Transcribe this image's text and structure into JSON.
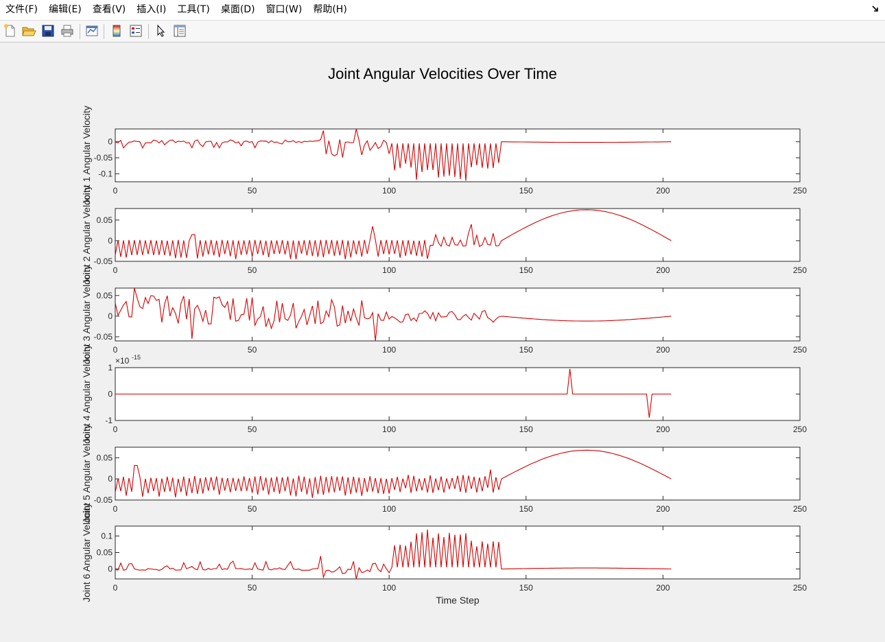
{
  "menubar": {
    "items": [
      {
        "label": "文件(F)",
        "name": "menu-file"
      },
      {
        "label": "编辑(E)",
        "name": "menu-edit"
      },
      {
        "label": "查看(V)",
        "name": "menu-view"
      },
      {
        "label": "插入(I)",
        "name": "menu-insert"
      },
      {
        "label": "工具(T)",
        "name": "menu-tools"
      },
      {
        "label": "桌面(D)",
        "name": "menu-desktop"
      },
      {
        "label": "窗口(W)",
        "name": "menu-window"
      },
      {
        "label": "帮助(H)",
        "name": "menu-help"
      }
    ]
  },
  "toolbar": {
    "buttons": [
      {
        "icon": "new-file-icon"
      },
      {
        "icon": "open-folder-icon"
      },
      {
        "icon": "save-icon"
      },
      {
        "icon": "print-icon"
      },
      {
        "icon": "link-plot-icon"
      },
      {
        "icon": "colorbar-icon"
      },
      {
        "icon": "legend-icon"
      },
      {
        "icon": "pointer-icon"
      },
      {
        "icon": "property-inspector-icon"
      }
    ]
  },
  "figure": {
    "title": "Joint Angular Velocities Over Time",
    "line_color": "#d40000"
  },
  "chart_data": [
    {
      "type": "line",
      "ylabel": "Joint 1 Angular Velocity",
      "xlim": [
        0,
        250
      ],
      "ylim": [
        -0.125,
        0.04
      ],
      "xticks": [
        0,
        50,
        100,
        150,
        200,
        250
      ],
      "yticks": [
        0,
        -0.05,
        -0.1
      ],
      "ytick_labels": [
        "0",
        "-0.05",
        "-0.1"
      ],
      "series": [
        {
          "x_max": 203,
          "pattern": "j1"
        }
      ]
    },
    {
      "type": "line",
      "ylabel": "Joint 2 Angular Velocity",
      "xlim": [
        0,
        250
      ],
      "ylim": [
        -0.05,
        0.078
      ],
      "xticks": [
        0,
        50,
        100,
        150,
        200,
        250
      ],
      "yticks": [
        0.05,
        0,
        -0.05
      ],
      "ytick_labels": [
        "0.05",
        "0",
        "-0.05"
      ],
      "series": [
        {
          "x_max": 203,
          "pattern": "j2"
        }
      ]
    },
    {
      "type": "line",
      "ylabel": "Joint 3 Angular Velocity",
      "xlim": [
        0,
        250
      ],
      "ylim": [
        -0.06,
        0.068
      ],
      "xticks": [
        0,
        50,
        100,
        150,
        200,
        250
      ],
      "yticks": [
        0.05,
        0,
        -0.05
      ],
      "ytick_labels": [
        "0.05",
        "0",
        "-0.05"
      ],
      "series": [
        {
          "x_max": 203,
          "pattern": "j3"
        }
      ]
    },
    {
      "type": "line",
      "ylabel": "Joint 4 Angular Velocity",
      "xlim": [
        0,
        250
      ],
      "ylim": [
        -1,
        1
      ],
      "xticks": [
        0,
        50,
        100,
        150,
        200,
        250
      ],
      "yticks": [
        1,
        0,
        -1
      ],
      "ytick_labels": [
        "1",
        "0",
        "-1"
      ],
      "exponent_label": "×10",
      "exponent_power": "-15",
      "series": [
        {
          "x_max": 203,
          "pattern": "j4"
        }
      ]
    },
    {
      "type": "line",
      "ylabel": "Joint 5 Angular Velocity",
      "xlim": [
        0,
        250
      ],
      "ylim": [
        -0.05,
        0.075
      ],
      "xticks": [
        0,
        50,
        100,
        150,
        200,
        250
      ],
      "yticks": [
        0.05,
        0,
        -0.05
      ],
      "ytick_labels": [
        "0.05",
        "0",
        "-0.05"
      ],
      "series": [
        {
          "x_max": 203,
          "pattern": "j5"
        }
      ]
    },
    {
      "type": "line",
      "ylabel": "Joint 6 Angular Velocity",
      "xlabel": "Time Step",
      "xlim": [
        0,
        250
      ],
      "ylim": [
        -0.03,
        0.13
      ],
      "xticks": [
        0,
        50,
        100,
        150,
        200,
        250
      ],
      "yticks": [
        0.1,
        0.05,
        0
      ],
      "ytick_labels": [
        "0.1",
        "0.05",
        "0"
      ],
      "series": [
        {
          "x_max": 203,
          "pattern": "j6"
        }
      ]
    }
  ]
}
